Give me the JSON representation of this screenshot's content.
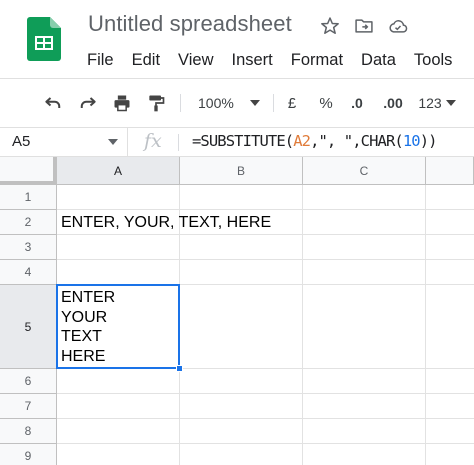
{
  "app": {
    "title": "Untitled spreadsheet",
    "brand_color": "#0f9d58",
    "title_icons": [
      "star-icon",
      "move-to-folder-icon",
      "cloud-status-icon"
    ]
  },
  "menu": [
    "File",
    "Edit",
    "View",
    "Insert",
    "Format",
    "Data",
    "Tools"
  ],
  "toolbar": {
    "zoom": "100%",
    "currency": "£",
    "percent": "%",
    "decrease_decimals": ".0",
    "increase_decimals": ".00",
    "number_format": "123"
  },
  "formula_bar": {
    "name_box": "A5",
    "fx_label": "fx",
    "formula_parts": [
      {
        "text": "=SUBSTITUTE(",
        "kind": "plain"
      },
      {
        "text": "A2",
        "kind": "ref"
      },
      {
        "text": ",\", \",CHAR(",
        "kind": "plain"
      },
      {
        "text": "10",
        "kind": "num"
      },
      {
        "text": "))",
        "kind": "plain"
      }
    ]
  },
  "sheet": {
    "columns": [
      "A",
      "B",
      "C"
    ],
    "rows": [
      "1",
      "2",
      "3",
      "4",
      "5",
      "6",
      "7",
      "8",
      "9"
    ],
    "active_cell": "A5",
    "selection_color": "#1a73e8",
    "cells": {
      "A2": "ENTER, YOUR, TEXT, HERE",
      "A5": "ENTER\nYOUR\nTEXT\nHERE"
    }
  }
}
